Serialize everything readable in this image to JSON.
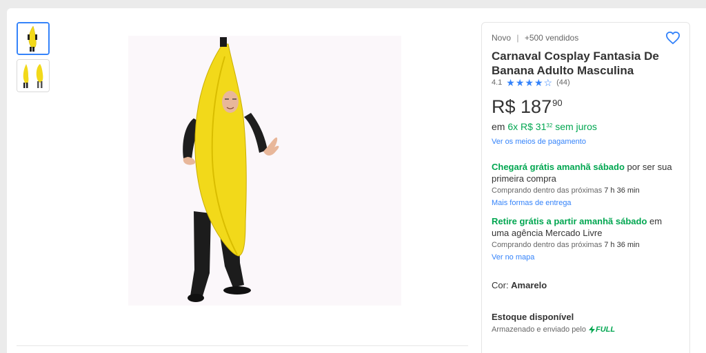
{
  "top": {
    "partial_link": "... "
  },
  "product": {
    "condition": "Novo",
    "separator": "|",
    "sold": "+500 vendidos",
    "title": "Carnaval Cosplay Fantasia De Banana Adulto Masculina",
    "rating": {
      "value": "4.1",
      "stars_filled": 4,
      "stars_total": 5,
      "count": "(44)"
    },
    "price": {
      "currency": "R$",
      "integer": "187",
      "cents": "90"
    },
    "installments": {
      "prefix": "em",
      "plan": "6x R$ 31",
      "cents": "32",
      "suffix": "sem juros"
    },
    "payment_link": "Ver os meios de pagamento"
  },
  "delivery": {
    "home_highlight": "Chegará grátis amanhã sábado",
    "home_rest": " por ser sua primeira compra",
    "home_timer_prefix": "Comprando dentro das próximas ",
    "home_timer": "7 h 36 min",
    "home_link": "Mais formas de entrega",
    "pickup_highlight": "Retire grátis a partir amanhã sábado",
    "pickup_rest": " em uma agência Mercado Livre",
    "pickup_timer_prefix": "Comprando dentro das próximas ",
    "pickup_timer": "7 h 36 min",
    "pickup_link": "Ver no mapa"
  },
  "variant": {
    "label": "Cor: ",
    "value": "Amarelo"
  },
  "stock": {
    "title": "Estoque disponível",
    "shipping_text": "Armazenado e enviado pelo",
    "full_label": "FULL"
  },
  "colors": {
    "accent": "#3483fa",
    "green": "#00a650",
    "banana": "#f2d91a"
  },
  "icons": [
    "heart-icon",
    "star-icon",
    "lightning-icon"
  ]
}
